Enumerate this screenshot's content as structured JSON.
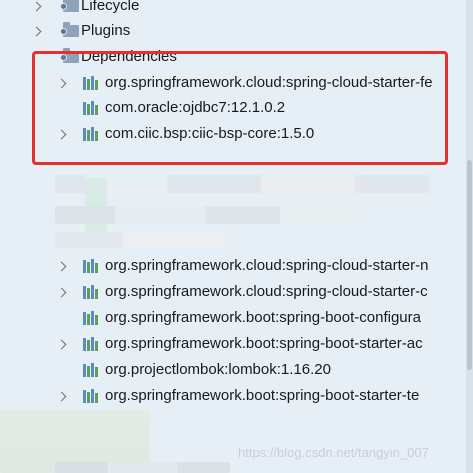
{
  "tree": {
    "nodes": [
      {
        "id": "lifecycle",
        "label": "Lifecycle"
      },
      {
        "id": "plugins",
        "label": "Plugins"
      },
      {
        "id": "dependencies",
        "label": "Dependencies"
      },
      {
        "id": "dep-cloud-fe",
        "label": "org.springframework.cloud:spring-cloud-starter-fe"
      },
      {
        "id": "dep-ojdbc7",
        "label": "com.oracle:ojdbc7:12.1.0.2"
      },
      {
        "id": "dep-ciic",
        "label": "com.ciic.bsp:ciic-bsp-core:1.5.0"
      },
      {
        "id": "dep-cloud-n",
        "label": "org.springframework.cloud:spring-cloud-starter-n"
      },
      {
        "id": "dep-cloud-c",
        "label": "org.springframework.cloud:spring-cloud-starter-c"
      },
      {
        "id": "dep-boot-config",
        "label": "org.springframework.boot:spring-boot-configura"
      },
      {
        "id": "dep-boot-ac",
        "label": "org.springframework.boot:spring-boot-starter-ac"
      },
      {
        "id": "dep-lombok",
        "label": "org.projectlombok:lombok:1.16.20"
      },
      {
        "id": "dep-boot-te",
        "label": "org.springframework.boot:spring-boot-starter-te"
      }
    ]
  },
  "watermark": "https://blog.csdn.net/tangyin_007",
  "colors": {
    "highlight": "#e53030",
    "library_icon_green": "#5aa05a",
    "library_icon_blue": "#5b8bbf"
  }
}
